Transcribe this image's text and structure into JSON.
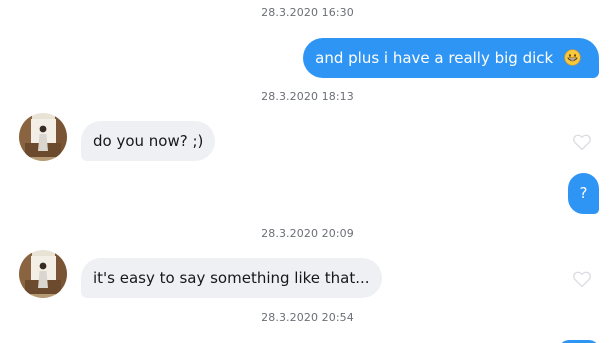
{
  "thread": {
    "messages": [
      {
        "timestamp": "28.3.2020 16:30",
        "direction": "out",
        "text": "and plus i have a really big dick",
        "emoji": "grinning-face-emoji"
      },
      {
        "timestamp": "28.3.2020 18:13",
        "direction": "in",
        "text": "do you now? ;)",
        "liked": false
      },
      {
        "direction": "out",
        "text": "?"
      },
      {
        "timestamp": "28.3.2020 20:09",
        "direction": "in",
        "text": "it's easy to say something like that...",
        "liked": false
      },
      {
        "timestamp": "28.3.2020 20:54",
        "direction": "out",
        "text": ""
      }
    ]
  },
  "colors": {
    "outgoing_bubble": "#2f95f4",
    "incoming_bubble": "#eff0f3",
    "timestamp_text": "#6b6f76",
    "like_icon": "#d9dbe0"
  },
  "icons": {
    "like": "heart-outline-icon",
    "avatar": "contact-avatar"
  }
}
